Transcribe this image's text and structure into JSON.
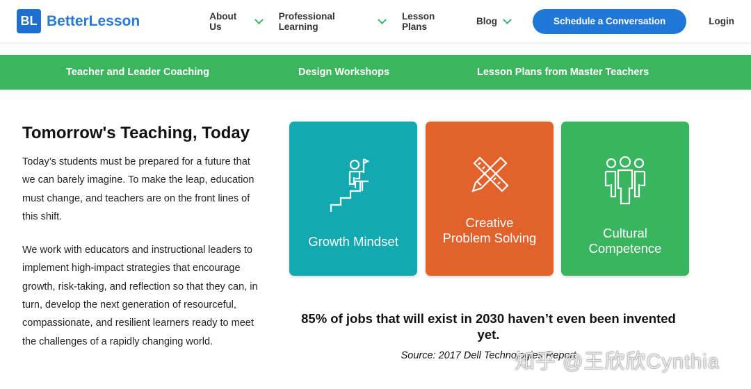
{
  "header": {
    "logo_mark": "BL",
    "logo_text": "BetterLesson",
    "nav": [
      {
        "label": "About Us",
        "dropdown": true
      },
      {
        "label": "Professional Learning",
        "dropdown": true
      },
      {
        "label": "Lesson Plans",
        "dropdown": false
      },
      {
        "label": "Blog",
        "dropdown": true
      }
    ],
    "cta": "Schedule a Conversation",
    "login": "Login"
  },
  "subnav": [
    "Teacher and Leader Coaching",
    "Design Workshops",
    "Lesson Plans from Master Teachers"
  ],
  "intro": {
    "title": "Tomorrow's Teaching, Today",
    "paragraphs": [
      "Today’s students must be prepared for a future that we can barely imagine. To make the leap, education must change, and teachers are on the front lines of this shift.",
      "We work with educators and instructional leaders to implement high-impact strategies that encourage growth, risk-taking, and reflection so that they can, in turn, develop the next generation of resourceful, compassionate, and resilient learners ready to meet the challenges of a rapidly changing world."
    ]
  },
  "cards": [
    {
      "line1": "Growth Mindset",
      "line2": "",
      "color": "#12a9b1",
      "icon": "stairs-climber-icon"
    },
    {
      "line1": "Creative",
      "line2": "Problem Solving",
      "color": "#e2622c",
      "icon": "pencil-ruler-icon"
    },
    {
      "line1": "Cultural",
      "line2": "Competence",
      "color": "#38b55e",
      "icon": "people-group-icon"
    }
  ],
  "quote": "85% of jobs that will exist in 2030 haven’t even been invented yet.",
  "source": "Source: 2017 Dell Technologies Report",
  "watermark": "知乎 @王欣欣Cynthia",
  "colors": {
    "brand": "#1f78d8",
    "green": "#3cb55e"
  }
}
